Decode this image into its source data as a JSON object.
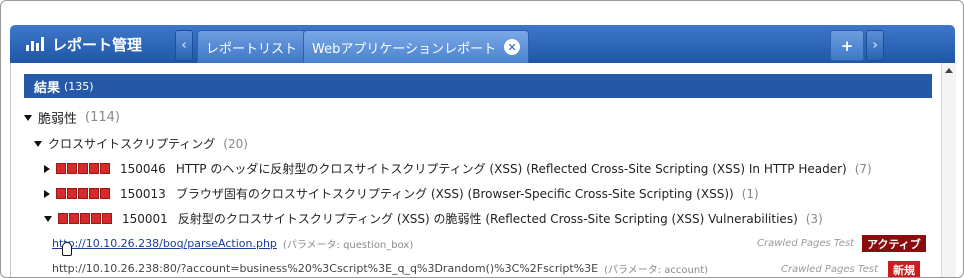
{
  "header": {
    "app_title": "レポート管理",
    "tabs": [
      {
        "label": "レポートリスト"
      },
      {
        "label": "Webアプリケーションレポート"
      }
    ],
    "add_label": "+",
    "prev_label": "‹",
    "next_label": "›",
    "close_label": "✕"
  },
  "results": {
    "label": "結果",
    "count": "(135)"
  },
  "tree": {
    "vuln": {
      "label": "脆弱性",
      "count": "(114)"
    },
    "xss": {
      "label": "クロスサイトスクリプティング",
      "count": "(20)"
    },
    "items": [
      {
        "id": "150046",
        "title": "HTTP のヘッダに反射型のクロスサイトスクリプティング (XSS) (Reflected Cross-Site Scripting (XSS) In HTTP Header)",
        "count": "(7)"
      },
      {
        "id": "150013",
        "title": "ブラウザ固有のクロスサイトスクリプティング (XSS) (Browser-Specific Cross-Site Scripting (XSS))",
        "count": "(1)"
      },
      {
        "id": "150001",
        "title": "反射型のクロスサイトスクリプティング (XSS) の脆弱性 (Reflected Cross-Site Scripting (XSS) Vulnerabilities)",
        "count": "(3)"
      }
    ],
    "details": [
      {
        "url": "http://10.10.26.238/boq/parseAction.php",
        "param": "(パラメータ: question_box)",
        "crawl": "Crawled Pages Test",
        "badge": "アクティブ"
      },
      {
        "url": "http://10.10.26.238:80/?account=business%20%3Cscript%3E_q_q%3Drandom()%3C%2Fscript%3E",
        "param": "(パラメータ: account)",
        "crawl": "Crawled Pages Test",
        "badge": "新規"
      }
    ]
  },
  "colors": {
    "header_blue": "#1f57a8",
    "results_bar": "#2559a8",
    "severity_red": "#d62a2a",
    "badge_active": "#8b0c0c",
    "badge_new": "#d11b1b"
  }
}
